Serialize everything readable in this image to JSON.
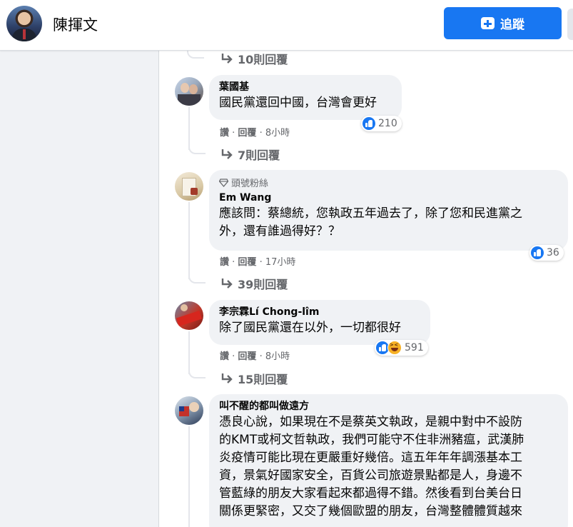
{
  "header": {
    "page_name": "陳揮文",
    "follow_label": "追蹤"
  },
  "icons": {
    "follow": "add-follow-icon",
    "reply_arrow": "reply-arrow-icon",
    "badge": "diamond-icon",
    "like": "like-reaction-icon",
    "haha": "haha-reaction-icon"
  },
  "colors": {
    "accent": "#1877f2",
    "bubble": "#f0f2f5",
    "muted_text": "#65676b"
  },
  "top_reply_link": "10則回覆",
  "comments": [
    {
      "author": "葉國基",
      "text": "國民黨還回中國，台灣會更好",
      "like_label": "讚",
      "reply_label": "回覆",
      "time": "8小時",
      "reaction_count": "210",
      "replies_link": "7則回覆"
    },
    {
      "badge": "頭號粉絲",
      "author": "Em Wang",
      "text_line1": "應該問：蔡總統，您執政五年過去了，除了您和民進黨之",
      "text_line2": "外，還有誰過得好？？",
      "like_label": "讚",
      "reply_label": "回覆",
      "time": "17小時",
      "reaction_count": "36",
      "replies_link": "39則回覆"
    },
    {
      "author": "李宗霖Lí Chong-lîm",
      "text": "除了國民黨還在以外，一切都很好",
      "like_label": "讚",
      "reply_label": "回覆",
      "time": "8小時",
      "reaction_count": "591",
      "replies_link": "15則回覆"
    },
    {
      "author": "叫不醒的都叫做遠方",
      "lines": [
        "憑良心說，如果現在不是蔡英文執政，是親中對中不設防",
        "的KMT或柯文哲執政，我們可能守不住非洲豬瘟，武漢肺",
        "炎疫情可能比現在更嚴重好幾倍。這五年年年調漲基本工",
        "資，景氣好國家安全，百貨公司旅遊景點都是人，身邊不",
        "管藍綠的朋友大家看起來都過得不錯。然後看到台美台日",
        "關係更緊密，又交了幾個歐盟的朋友，台灣整體體質越來"
      ]
    }
  ]
}
